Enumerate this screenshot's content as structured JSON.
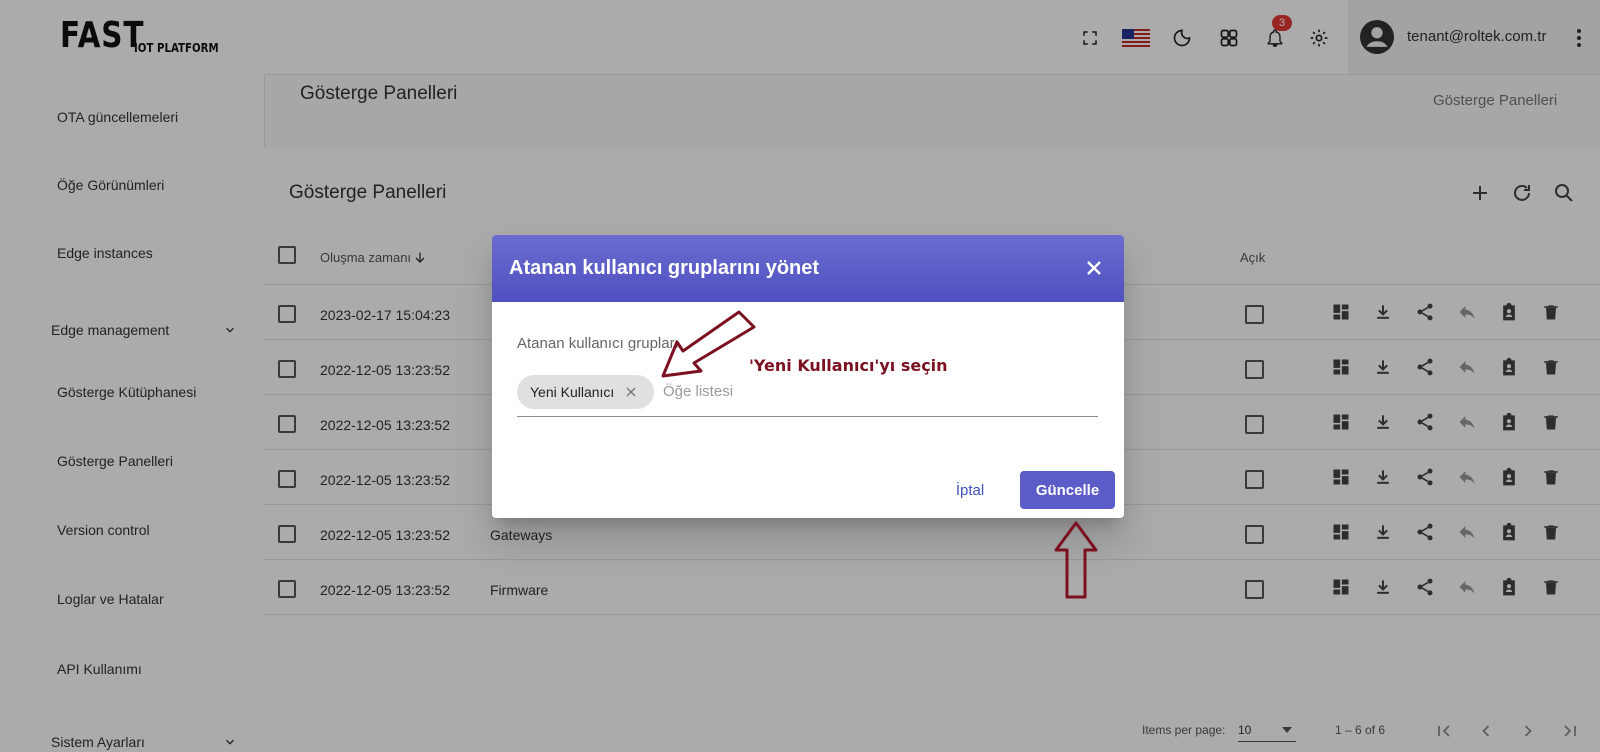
{
  "logo": {
    "main": "FAST",
    "sub": "IOT PLATFORM"
  },
  "sidebar": {
    "items": [
      {
        "label": "OTA güncellemeleri"
      },
      {
        "label": "Öğe Görünümleri"
      },
      {
        "label": "Edge instances"
      },
      {
        "label": "Edge management"
      },
      {
        "label": "Gösterge Kütüphanesi"
      },
      {
        "label": "Gösterge Panelleri"
      },
      {
        "label": "Version control"
      },
      {
        "label": "Loglar ve Hatalar"
      },
      {
        "label": "API Kullanımı"
      },
      {
        "label": "Sistem Ayarları"
      }
    ]
  },
  "header": {
    "notification_count": "3",
    "user_email": "tenant@roltek.com.tr"
  },
  "page": {
    "title": "Gösterge Panelleri",
    "breadcrumb": "Gösterge Panelleri",
    "card_title": "Gösterge Panelleri"
  },
  "table": {
    "headers": {
      "created": "Oluşma zamanı",
      "public": "Açık"
    },
    "rows": [
      {
        "created": "2023-02-17 15:04:23",
        "title": ""
      },
      {
        "created": "2022-12-05 13:23:52",
        "title": ""
      },
      {
        "created": "2022-12-05 13:23:52",
        "title": ""
      },
      {
        "created": "2022-12-05 13:23:52",
        "title": ""
      },
      {
        "created": "2022-12-05 13:23:52",
        "title": "Gateways"
      },
      {
        "created": "2022-12-05 13:23:52",
        "title": "Firmware"
      }
    ]
  },
  "paginator": {
    "items_per_page_label": "Items per page:",
    "page_size": "10",
    "range": "1 – 6 of 6"
  },
  "dialog": {
    "title": "Atanan kullanıcı gruplarını yönet",
    "field_label": "Atanan kullanıcı grupları",
    "chip": "Yeni Kullanıcı",
    "placeholder": "Öğe listesi",
    "cancel_label": "İptal",
    "update_label": "Güncelle"
  },
  "annotation": {
    "text": "'Yeni Kullanıcı'yı seçin",
    "color": "#7b1020"
  },
  "colors": {
    "dialog_header": "#5b5cc7",
    "badge": "#e53935"
  }
}
